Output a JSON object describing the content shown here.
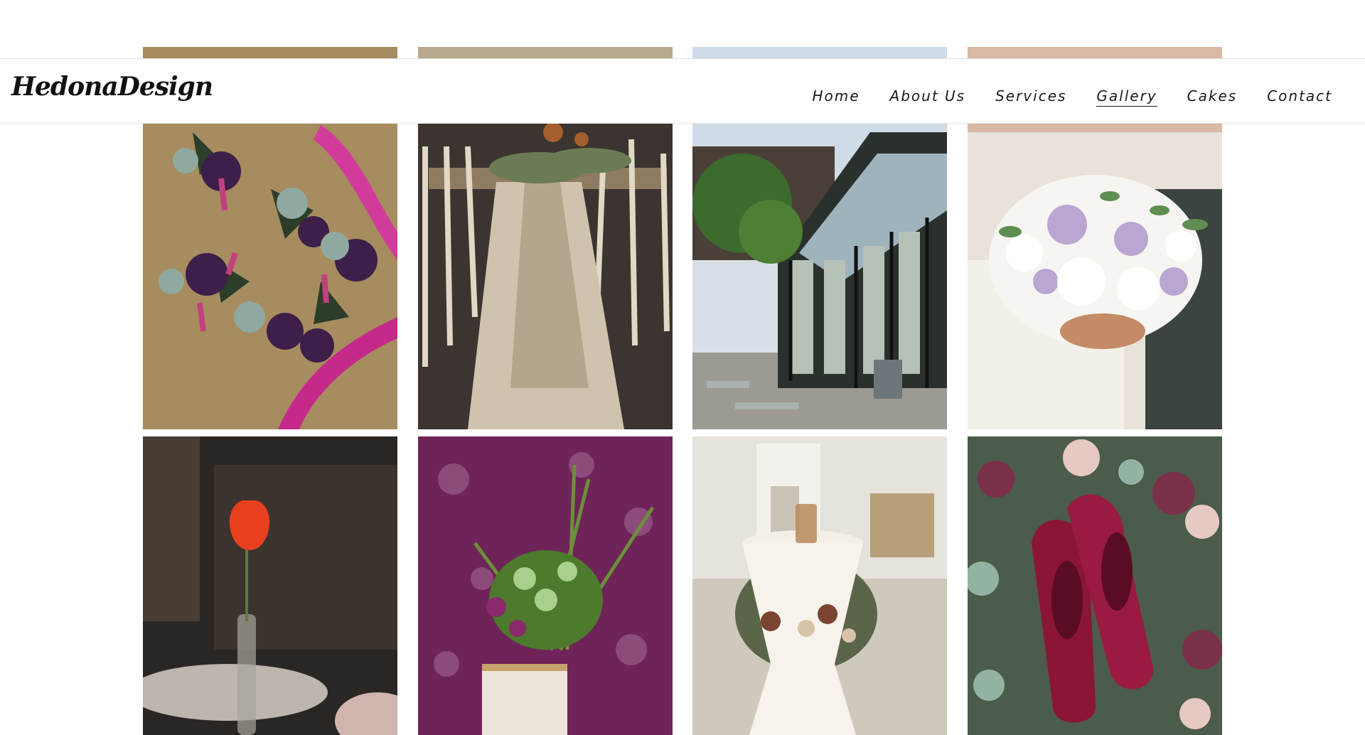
{
  "brand": {
    "logo_text": "HedonaDesign"
  },
  "nav": {
    "items": [
      "Home",
      "About Us",
      "Services",
      "Gallery",
      "Cakes",
      "Contact"
    ],
    "active": "Gallery"
  },
  "gallery": {
    "tiles": [
      "boutonnieres-thistle",
      "banquet-table-runner",
      "glass-greenhouse",
      "bridal-bouquet",
      "red-anthurium-bottle",
      "purple-wall-lace-vase",
      "cocktail-table-drape",
      "burgundy-shoes-florals"
    ]
  },
  "colors": {
    "accent_magenta": "#c52a8a",
    "plum": "#7a2a63",
    "burgundy": "#8a1537",
    "anthurium_red": "#e8401f"
  }
}
